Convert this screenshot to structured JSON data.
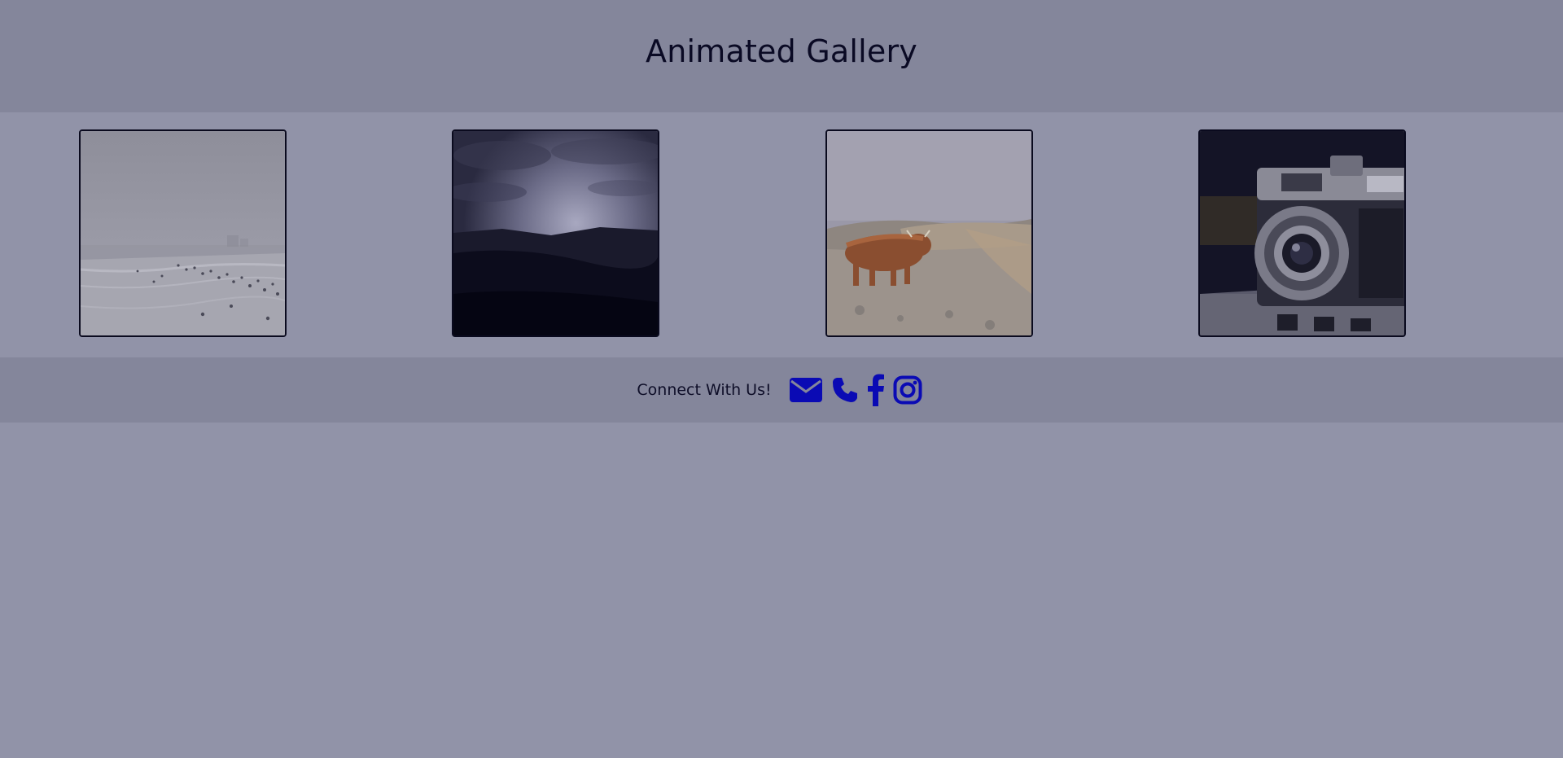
{
  "header": {
    "title": "Animated Gallery"
  },
  "gallery": {
    "photos": [
      {
        "subject": "foggy beach with people"
      },
      {
        "subject": "dark cloudy sunset over hills"
      },
      {
        "subject": "highland cow on coastal cliffs"
      },
      {
        "subject": "vintage camera close-up"
      }
    ]
  },
  "footer": {
    "connect_label": "Connect With Us!",
    "icons": [
      "envelope-icon",
      "phone-icon",
      "facebook-icon",
      "instagram-icon"
    ],
    "icon_color": "#0a0ab4"
  },
  "colors": {
    "header_bg": "#84869b",
    "page_bg": "#9193a8",
    "title_color": "#0a0a24"
  }
}
